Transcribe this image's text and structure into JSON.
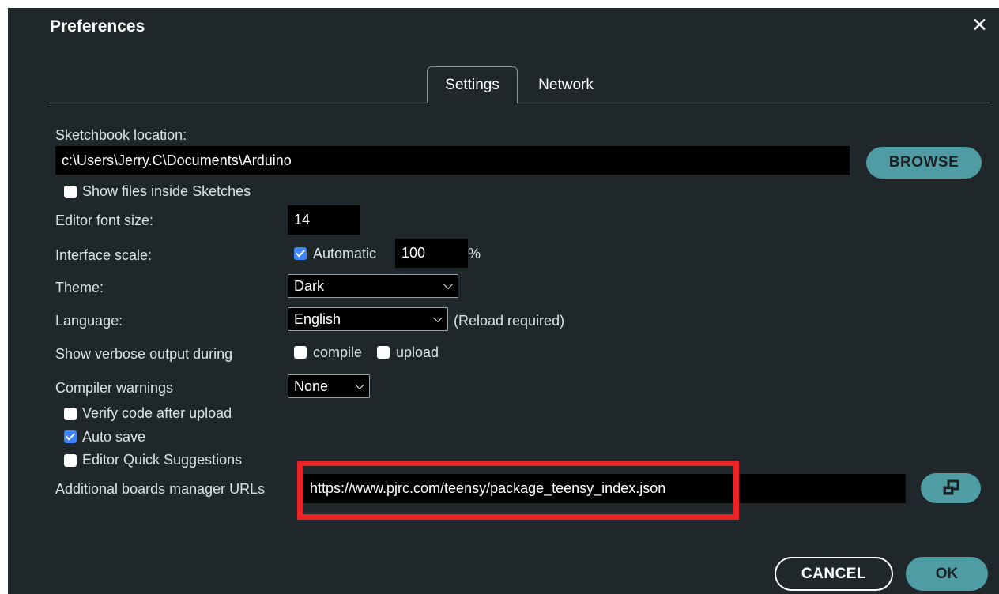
{
  "dialog": {
    "title": "Preferences",
    "close_icon": "close-icon",
    "tabs": [
      {
        "label": "Settings",
        "active": true
      },
      {
        "label": "Network",
        "active": false
      }
    ]
  },
  "settings": {
    "sketchbook_label": "Sketchbook location:",
    "sketchbook_value": "c:\\Users\\Jerry.C\\Documents\\Arduino",
    "browse_label": "BROWSE",
    "show_files_label": "Show files inside Sketches",
    "show_files_checked": false,
    "font_size_label": "Editor font size:",
    "font_size_value": "14",
    "scale_label": "Interface scale:",
    "scale_automatic_label": "Automatic",
    "scale_automatic_checked": true,
    "scale_value": "100",
    "scale_unit": "%",
    "theme_label": "Theme:",
    "theme_value": "Dark",
    "language_label": "Language:",
    "language_value": "English",
    "language_note": "(Reload required)",
    "verbose_label": "Show verbose output during",
    "verbose_compile_label": "compile",
    "verbose_compile_checked": false,
    "verbose_upload_label": "upload",
    "verbose_upload_checked": false,
    "warnings_label": "Compiler warnings",
    "warnings_value": "None",
    "verify_label": "Verify code after upload",
    "verify_checked": false,
    "autosave_label": "Auto save",
    "autosave_checked": true,
    "quick_suggestions_label": "Editor Quick Suggestions",
    "quick_suggestions_checked": false,
    "boards_urls_label": "Additional boards manager URLs",
    "boards_urls_value": "https://www.pjrc.com/teensy/package_teensy_index.json",
    "boards_urls_button_icon": "open-window-icon"
  },
  "footer": {
    "cancel_label": "CANCEL",
    "ok_label": "OK"
  },
  "colors": {
    "background": "#1f272a",
    "accent": "#4f9ca4",
    "checkbox_checked": "#3d86ff",
    "highlight_box": "#ed2024"
  }
}
